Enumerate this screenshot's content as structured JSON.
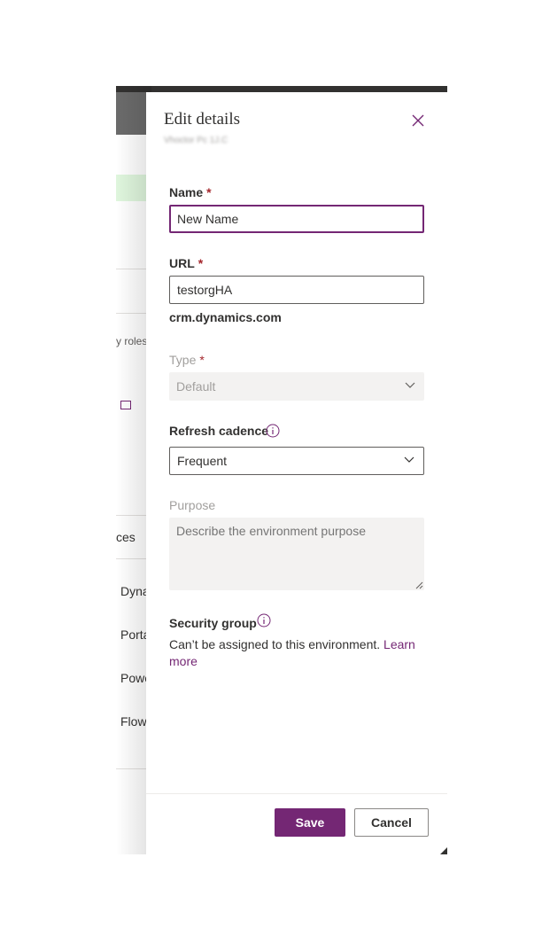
{
  "background": {
    "partial_texts": [
      "y roles",
      "ces",
      "Dyna",
      "Porta",
      "Powe",
      "Flow"
    ]
  },
  "panel": {
    "title": "Edit details",
    "subtitle": "Vhoctor Pc 1J.C",
    "close_icon": "close-icon"
  },
  "form": {
    "name": {
      "label": "Name",
      "required_mark": "*",
      "value": "New Name"
    },
    "url": {
      "label": "URL",
      "required_mark": "*",
      "value": "testorgHA",
      "suffix": "crm.dynamics.com"
    },
    "type": {
      "label": "Type",
      "required_mark": "*",
      "value": "Default",
      "disabled": true
    },
    "refresh_cadence": {
      "label": "Refresh cadence",
      "value": "Frequent",
      "info_icon": "info-icon"
    },
    "purpose": {
      "label": "Purpose",
      "placeholder": "Describe the environment purpose",
      "disabled": true
    },
    "security_group": {
      "label": "Security group",
      "info_icon": "info-icon",
      "description": "Can’t be assigned to this environment.",
      "link_text": "Learn more"
    }
  },
  "footer": {
    "save_label": "Save",
    "cancel_label": "Cancel"
  },
  "colors": {
    "accent": "#742774",
    "required": "#a4262c",
    "disabled_bg": "#f3f2f1",
    "topbar": "#323130"
  }
}
